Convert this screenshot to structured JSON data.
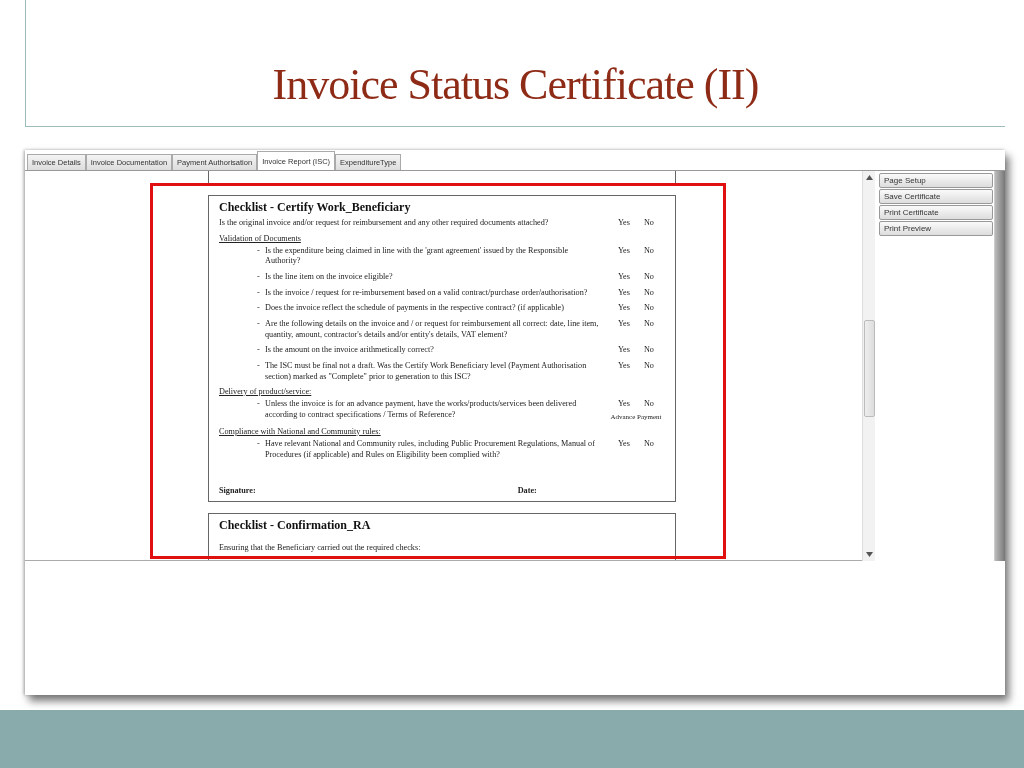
{
  "slide": {
    "title": "Invoice Status Certificate (II)"
  },
  "tabs": [
    {
      "label": "Invoice Details",
      "selected": false
    },
    {
      "label": "Invoice Documentation",
      "selected": false
    },
    {
      "label": "Payment Authorisation",
      "selected": false
    },
    {
      "label": "Invoice Report (ISC)",
      "selected": true
    },
    {
      "label": "ExpenditureType",
      "selected": false
    }
  ],
  "checklists": [
    {
      "title": "Checklist - Certify Work_Beneficiary",
      "items": [
        {
          "kind": "question",
          "text": "Is the original invoice and/or request for reimbursement and any other required documents attached?",
          "yes": "Yes",
          "no": "No"
        },
        {
          "kind": "heading",
          "text": "Validation of Documents"
        },
        {
          "kind": "question",
          "marker": "-",
          "text": "Is the expenditure being claimed in line with the 'grant agreement' issued by the Responsible Authority?",
          "yes": "Yes",
          "no": "No"
        },
        {
          "kind": "question",
          "marker": "-",
          "text": "Is the line item on the invoice eligible?",
          "yes": "Yes",
          "no": "No"
        },
        {
          "kind": "question",
          "marker": "-",
          "text": "Is the invoice / request for re-imbursement based on a valid contract/purchase order/authorisation?",
          "yes": "Yes",
          "no": "No"
        },
        {
          "kind": "question",
          "marker": "-",
          "text": "Does the invoice reflect the schedule of payments in the respective contract? (if applicable)",
          "yes": "Yes",
          "no": "No"
        },
        {
          "kind": "question",
          "marker": "-",
          "text": "Are the following details on the invoice and / or request for reimbursement all correct: date, line item, quantity, amount, contractor's details and/or entity's details, VAT element?",
          "yes": "Yes",
          "no": "No"
        },
        {
          "kind": "question",
          "marker": "-",
          "text": "Is the amount on the invoice arithmetically correct?",
          "yes": "Yes",
          "no": "No"
        },
        {
          "kind": "question",
          "marker": "-",
          "text": "The ISC must be final not a draft. Was the Certify Work Beneficiary level (Payment Authorisation section) marked as \"Complete\" prior to generation to this ISC?",
          "yes": "Yes",
          "no": "No"
        },
        {
          "kind": "heading",
          "text": "Delivery of product/service:"
        },
        {
          "kind": "question",
          "marker": "-",
          "text": "Unless the invoice is for an advance payment, have the works/products/services been delivered according to contract specifications / Terms of Reference?",
          "yes": "Yes",
          "no": "No",
          "note": "Advance Payment"
        },
        {
          "kind": "heading",
          "text": "Compliance with National and Community rules:"
        },
        {
          "kind": "question",
          "marker": "-",
          "text": "Have relevant National and Community rules, including Public Procurement Regulations, Manual of Procedures (if applicable) and Rules on Eligibility been complied with?",
          "yes": "Yes",
          "no": "No"
        }
      ],
      "signature": "Signature:",
      "date": "Date:"
    },
    {
      "title": "Checklist - Confirmation_RA",
      "intro": "Ensuring that the Beneficiary carried out the required checks:"
    }
  ],
  "actions": [
    "Page Setup",
    "Save Certificate",
    "Print Certificate",
    "Print Preview"
  ]
}
